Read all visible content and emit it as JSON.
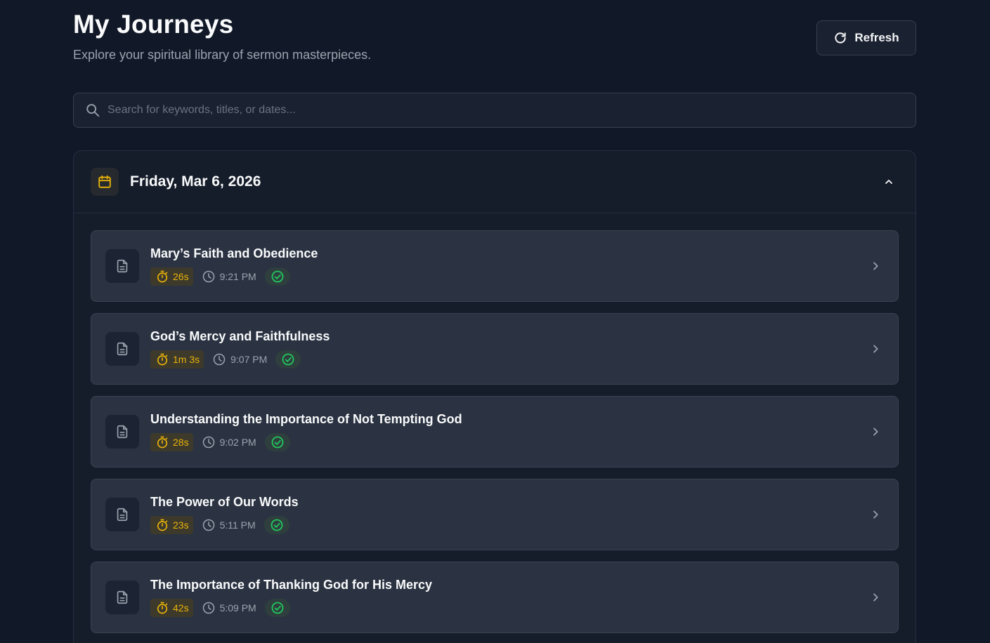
{
  "header": {
    "title": "My Journeys",
    "subtitle": "Explore your spiritual library of sermon masterpieces.",
    "refresh_label": "Refresh"
  },
  "search": {
    "placeholder": "Search for keywords, titles, or dates...",
    "value": ""
  },
  "group": {
    "date": "Friday, Mar 6, 2026",
    "expanded": true
  },
  "items": [
    {
      "title": "Mary’s Faith and Obedience",
      "duration": "26s",
      "time": "9:21 PM",
      "status": "completed"
    },
    {
      "title": "God’s Mercy and Faithfulness",
      "duration": "1m 3s",
      "time": "9:07 PM",
      "status": "completed"
    },
    {
      "title": "Understanding the Importance of Not Tempting God",
      "duration": "28s",
      "time": "9:02 PM",
      "status": "completed"
    },
    {
      "title": "The Power of Our Words",
      "duration": "23s",
      "time": "5:11 PM",
      "status": "completed"
    },
    {
      "title": "The Importance of Thanking God for His Mercy",
      "duration": "42s",
      "time": "5:09 PM",
      "status": "completed"
    }
  ],
  "colors": {
    "background": "#111827",
    "accent_yellow": "#eab308",
    "success_green": "#22c55e"
  },
  "icons": {
    "refresh": "refresh-icon",
    "search": "search-icon",
    "calendar": "calendar-icon",
    "collapse": "chevron-up-icon",
    "document": "document-icon",
    "duration": "stopwatch-icon",
    "time": "clock-icon",
    "status": "check-circle-icon",
    "open": "chevron-right-icon"
  }
}
